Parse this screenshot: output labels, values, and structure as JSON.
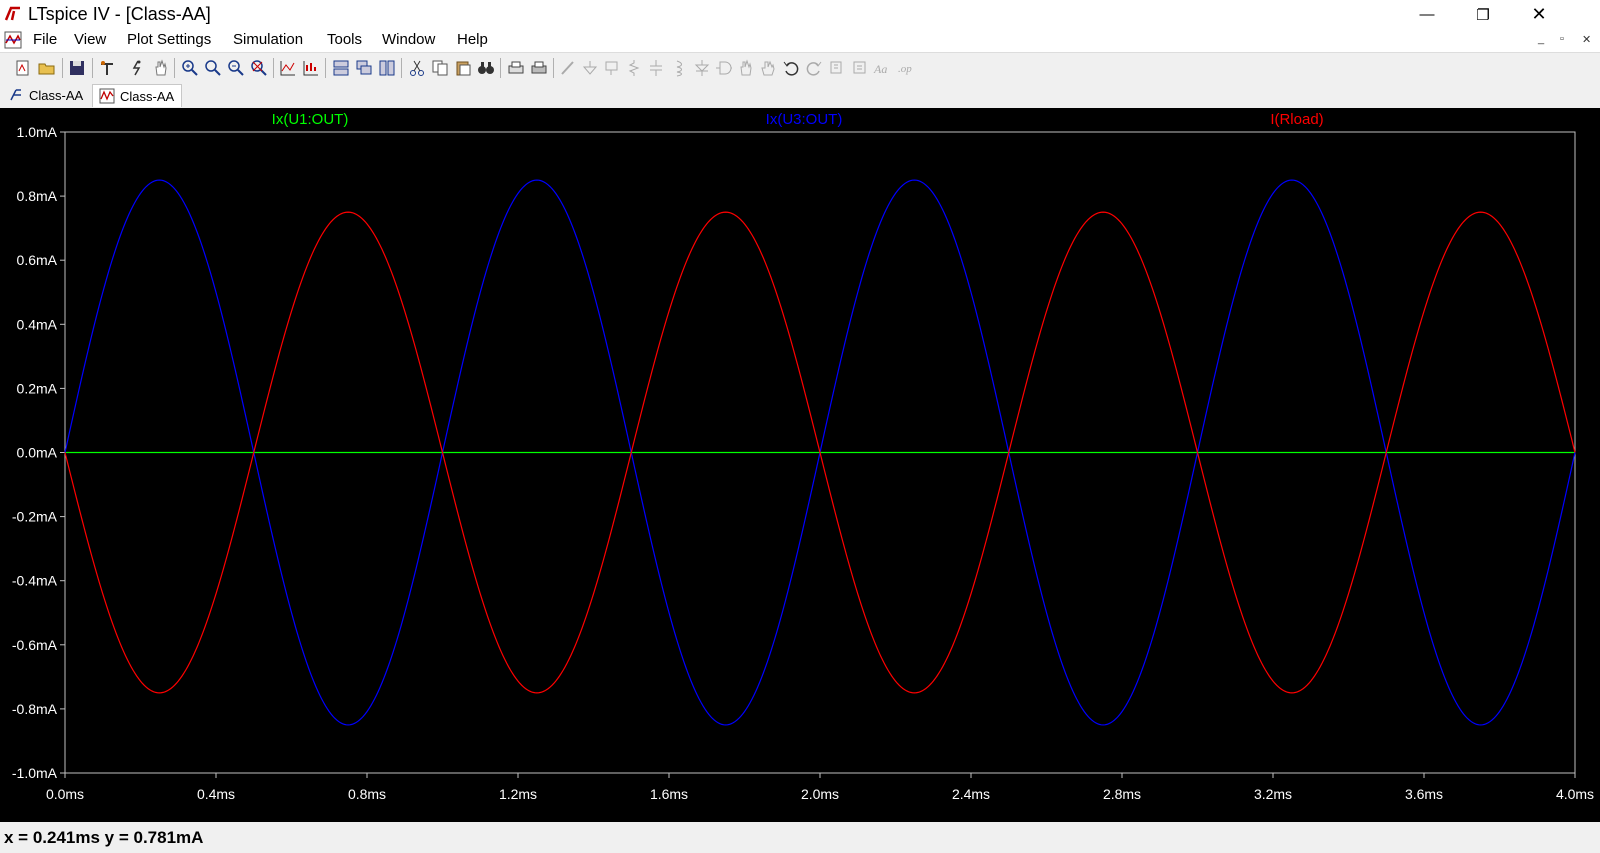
{
  "window": {
    "title": "LTspice IV - [Class-AA]",
    "controls": {
      "minimize": "—",
      "maximize": "❐",
      "close": "✕"
    }
  },
  "menu": {
    "items": [
      "File",
      "View",
      "Plot Settings",
      "Simulation",
      "Tools",
      "Window",
      "Help"
    ],
    "mdi_controls": {
      "minimize": "_",
      "restore": "▫",
      "close": "✕"
    }
  },
  "toolbar": {
    "icons": [
      "new-schematic-icon",
      "open-icon",
      "save-icon",
      "control-panel-icon",
      "run-icon",
      "pan-icon",
      "zoom-in-icon",
      "zoom-area-icon",
      "zoom-out-icon",
      "zoom-fit-icon",
      "autorange-icon",
      "plot-settings-icon",
      "tile-horizontal-icon",
      "cascade-icon",
      "tile-vertical-icon",
      "cut-icon",
      "copy-icon",
      "paste-icon",
      "find-icon",
      "print-setup-icon",
      "print-icon",
      "draw-wire-icon",
      "ground-icon",
      "label-net-icon",
      "resistor-icon",
      "capacitor-icon",
      "inductor-icon",
      "diode-icon",
      "component-icon",
      "move-icon",
      "drag-icon",
      "undo-icon",
      "redo-icon",
      "rotate-icon",
      "mirror-icon",
      "text-icon",
      "spice-directive-icon"
    ]
  },
  "tabs": [
    {
      "label": "Class-AA",
      "type": "schematic",
      "active": false
    },
    {
      "label": "Class-AA",
      "type": "waveform",
      "active": true
    }
  ],
  "chart_data": {
    "type": "line",
    "title": "",
    "xlabel": "",
    "ylabel": "",
    "xlim": [
      0,
      4.0
    ],
    "ylim": [
      -1.0,
      1.0
    ],
    "x_unit": "ms",
    "y_unit": "mA",
    "x_ticks": [
      "0.0ms",
      "0.4ms",
      "0.8ms",
      "1.2ms",
      "1.6ms",
      "2.0ms",
      "2.4ms",
      "2.8ms",
      "3.2ms",
      "3.6ms",
      "4.0ms"
    ],
    "y_ticks": [
      "1.0mA",
      "0.8mA",
      "0.6mA",
      "0.4mA",
      "0.2mA",
      "0.0mA",
      "-0.2mA",
      "-0.4mA",
      "-0.6mA",
      "-0.8mA",
      "-1.0mA"
    ],
    "background": "#000000",
    "frame_color": "#c0c0c0",
    "grid": false,
    "series": [
      {
        "name": "Ix(U1:OUT)",
        "color": "#00ff00",
        "waveform": "constant",
        "amplitude_mA": 0.0,
        "frequency_kHz": 1.0
      },
      {
        "name": "Ix(U3:OUT)",
        "color": "#0000ff",
        "waveform": "sine",
        "amplitude_mA": 0.85,
        "frequency_kHz": 1.0
      },
      {
        "name": "I(Rload)",
        "color": "#ff0000",
        "waveform": "negative-sine",
        "amplitude_mA": 0.75,
        "frequency_kHz": 1.0
      }
    ]
  },
  "status": {
    "cursor_readout": "x = 0.241ms    y = 0.781mA"
  }
}
